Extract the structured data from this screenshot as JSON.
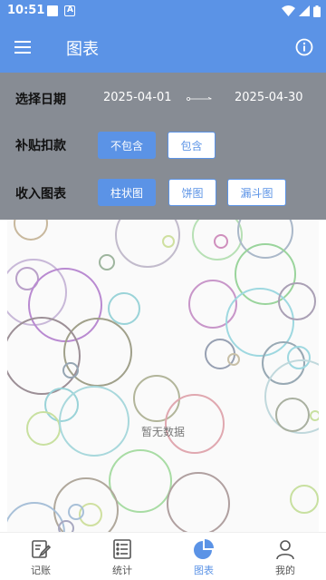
{
  "status_bar": {
    "time": "10:51",
    "icons": [
      "square-notification-icon",
      "a-notification-icon",
      "wifi-icon",
      "signal-icon",
      "battery-icon"
    ]
  },
  "app_bar": {
    "title": "图表",
    "menu_icon": "hamburger-menu-icon",
    "info_icon": "info-icon"
  },
  "filters": {
    "date_label": "选择日期",
    "start_date": "2025-04-01",
    "end_date": "2025-04-30",
    "subsidy_label": "补贴扣款",
    "subsidy_options": [
      "不包含",
      "包含"
    ],
    "subsidy_selected": "不包含",
    "chart_label": "收入图表",
    "chart_options": [
      "柱状图",
      "饼图",
      "漏斗图"
    ],
    "chart_selected": "柱状图"
  },
  "chart": {
    "empty_text": "暂无数据"
  },
  "bottom_nav": {
    "items": [
      {
        "label": "记账",
        "icon": "edit-record-icon"
      },
      {
        "label": "统计",
        "icon": "list-stats-icon"
      },
      {
        "label": "图表",
        "icon": "pie-chart-icon"
      },
      {
        "label": "我的",
        "icon": "person-icon"
      }
    ],
    "active": "图表"
  },
  "colors": {
    "primary": "#5b93e6",
    "panel": "#878c94",
    "chart_bg": "#fafafa"
  }
}
